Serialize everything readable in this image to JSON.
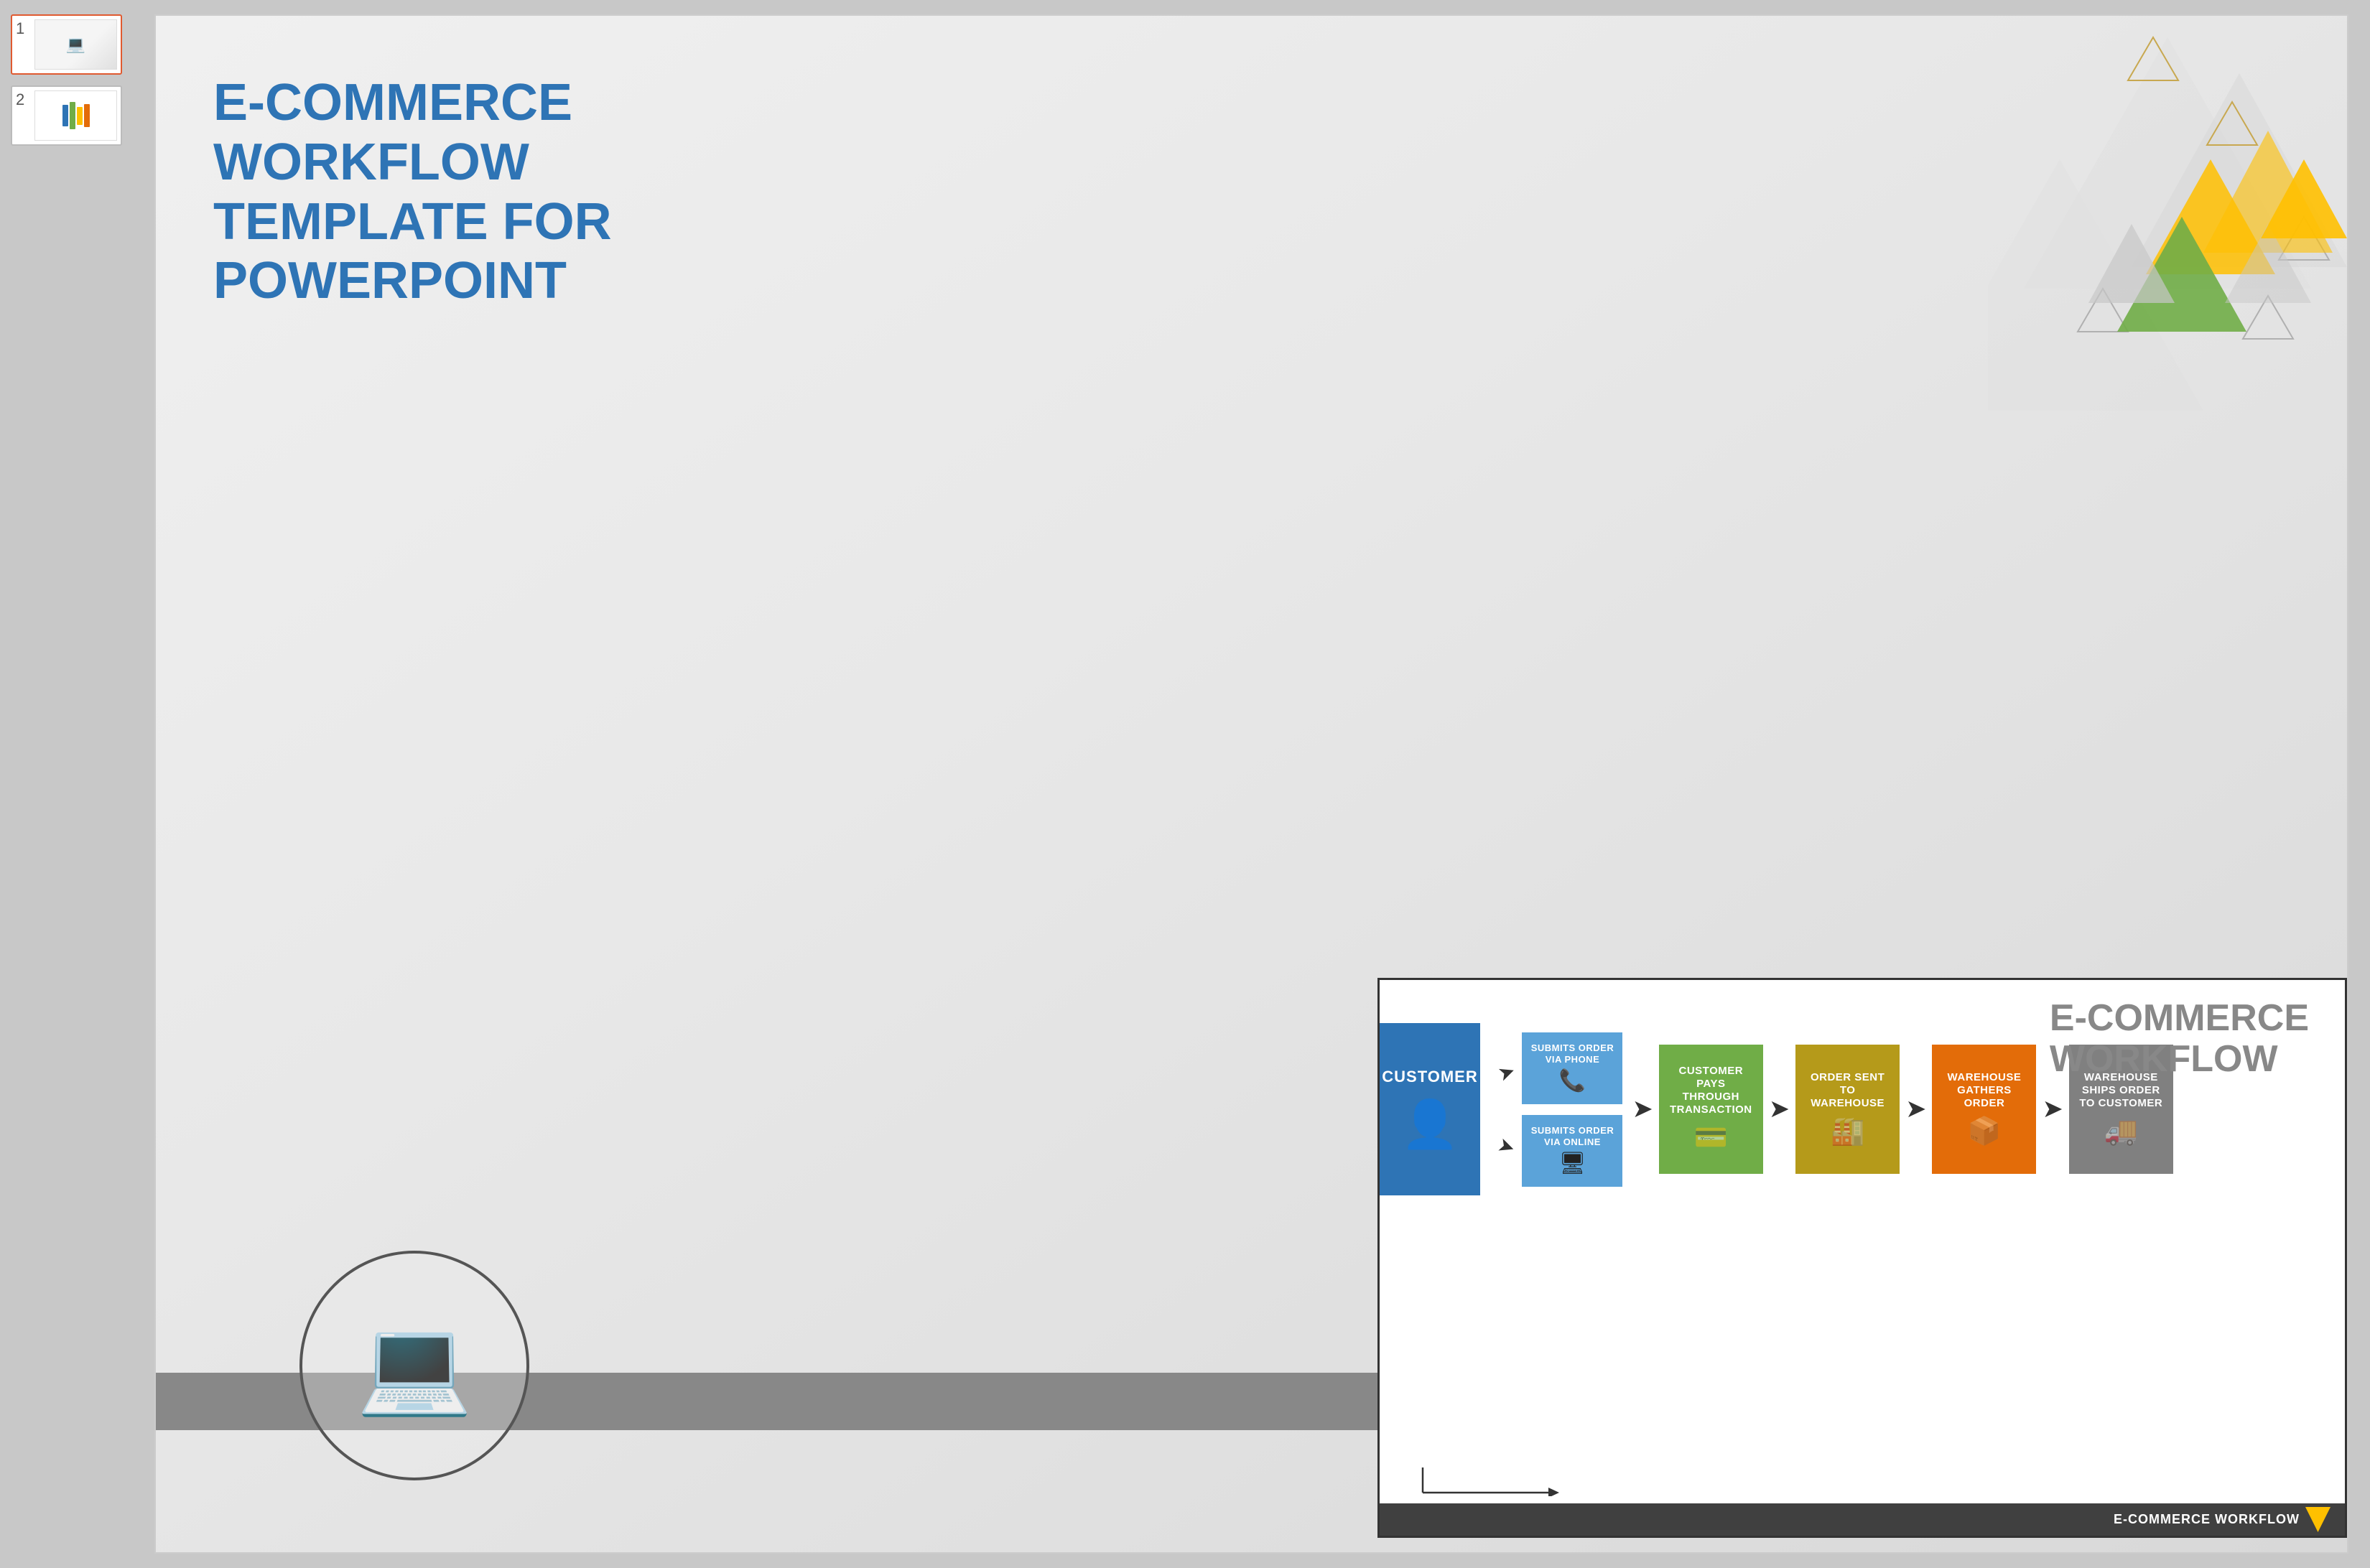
{
  "sidebar": {
    "slide1_number": "1",
    "slide2_number": "2"
  },
  "slide1": {
    "title_line1": "E-COMMERCE WORKFLOW",
    "title_line2": "TEMPLATE FOR POWERPOINT"
  },
  "workflow": {
    "title_line1": "E-COMMERCE",
    "title_line2": "WORKFLOW",
    "customer_label": "CUSTOMER",
    "submit_phone_label": "SUBMITS ORDER VIA PHONE",
    "submit_online_label": "SUBMITS ORDER VIA ONLINE",
    "pays_label": "CUSTOMER PAYS THROUGH TRANSACTION",
    "order_sent_label": "ORDER SENT TO WAREHOUSE",
    "gathers_label": "WAREHOUSE GATHERS ORDER",
    "ships_label": "WAREHOUSE SHIPS ORDER TO CUSTOMER",
    "footer_text": "E-COMMERCE WORKFLOW"
  }
}
